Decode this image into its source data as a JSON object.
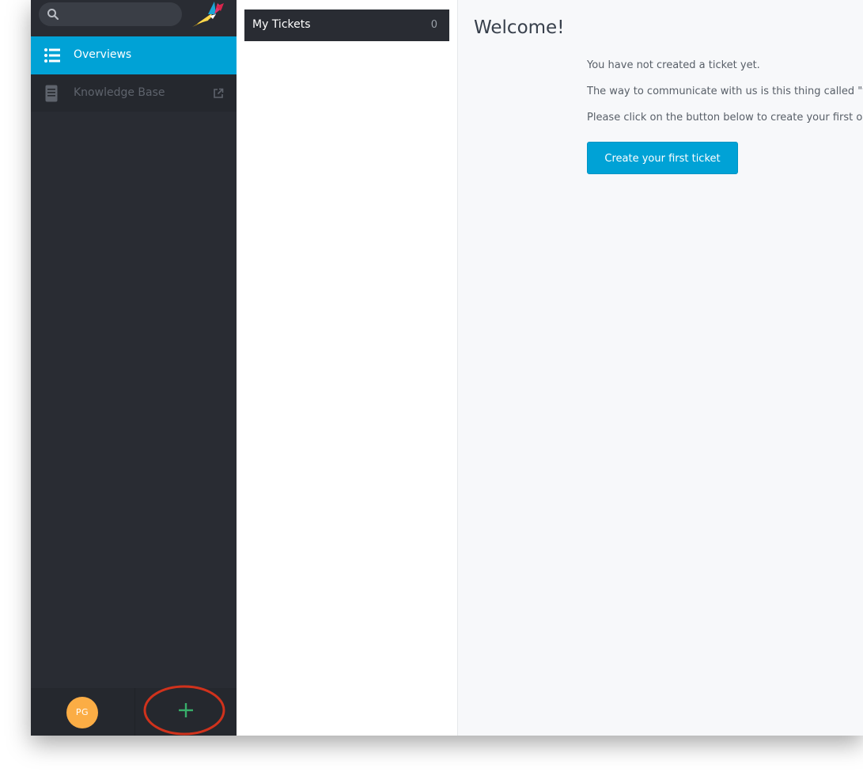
{
  "search": {
    "placeholder": ""
  },
  "nav": {
    "overviews_label": "Overviews",
    "knowledge_base_label": "Knowledge Base"
  },
  "user": {
    "initials": "PG"
  },
  "overviews": [
    {
      "label": "My Tickets",
      "count": "0"
    }
  ],
  "main": {
    "title": "Welcome!",
    "lines": [
      "You have not created a ticket yet.",
      "The way to communicate with us is this thing called \"ticket\".",
      "Please click on the button below to create your first one."
    ],
    "create_button_label": "Create your first ticket"
  },
  "colors": {
    "accent": "#00a2d6",
    "sidebar_bg": "#292c33",
    "avatar_bg": "#fbad45",
    "new_button_plus": "#38ae6a",
    "highlight": "#d0321c"
  },
  "icons": {
    "search": "search-icon",
    "logo": "app-logo-icon",
    "overviews": "list-icon",
    "knowledge_base": "book-icon",
    "external": "external-link-icon",
    "new": "plus-icon"
  }
}
